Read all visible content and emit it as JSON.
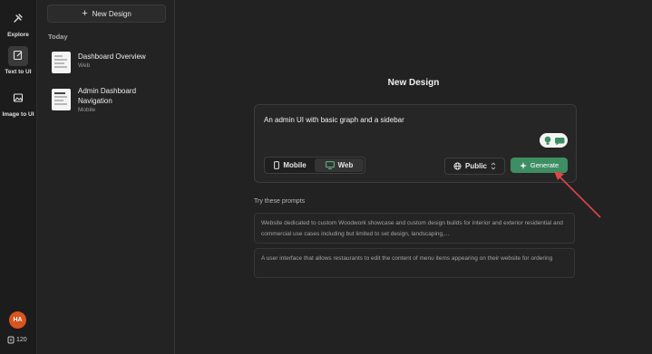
{
  "rail": {
    "items": [
      {
        "label": "Explore",
        "icon": "explore-icon"
      },
      {
        "label": "Text to UI",
        "icon": "edit-icon"
      },
      {
        "label": "Image to UI",
        "icon": "image-icon"
      }
    ],
    "avatar_initials": "HA",
    "credits": "120"
  },
  "history": {
    "new_button": "New Design",
    "section": "Today",
    "items": [
      {
        "title": "Dashboard Overview",
        "platform": "Web"
      },
      {
        "title": "Admin Dashboard Navigation",
        "platform": "Mobile"
      }
    ]
  },
  "main": {
    "title": "New Design",
    "prompt": "An admin UI with basic graph and a sidebar",
    "platform_options": [
      "Mobile",
      "Web"
    ],
    "selected_platform": "Web",
    "visibility": "Public",
    "generate_label": "Generate",
    "try_label": "Try these prompts",
    "suggestions": [
      "Website dedicated to custom Woodwork showcase and custom design builds for interior and exterior residential and commercial use cases including but limited to set design, landscaping,...",
      "A user interface that allows restaurants to edit the content of menu items appearing on their website for ordering"
    ]
  },
  "colors": {
    "accent": "#3e8e63",
    "avatar": "#d9541e",
    "annotation_arrow": "#e04646"
  }
}
